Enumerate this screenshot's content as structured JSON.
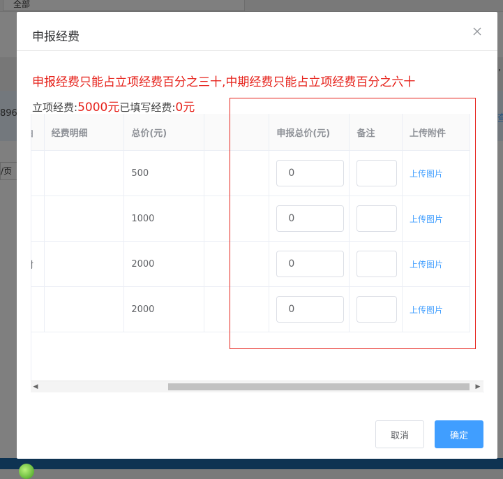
{
  "background": {
    "topbar_select": "全部",
    "left_fragments": [
      "896)",
      "/页",
      "由",
      "材"
    ],
    "right_fragments": [
      "’",
      "查"
    ]
  },
  "dialog": {
    "title": "申报经费",
    "notice": "申报经费只能占立项经费百分之三十,中期经费只能占立项经费百分之六十",
    "budget": {
      "label1": "立项经费:",
      "value1": "5000元",
      "label2": "已填写经费:",
      "value2": "0元"
    },
    "table": {
      "headers": {
        "reason": "由",
        "detail": "经费明细",
        "total": "总价(元)",
        "blank": "",
        "declared": "申报总价(元)",
        "remark": "备注",
        "upload": "上传附件"
      },
      "rows": [
        {
          "reason": "",
          "detail": "",
          "total": "500",
          "declared": "0",
          "remark": "",
          "upload": "上传图片"
        },
        {
          "reason": "",
          "detail": "",
          "total": "1000",
          "declared": "0",
          "remark": "",
          "upload": "上传图片"
        },
        {
          "reason": "材",
          "detail": "",
          "total": "2000",
          "declared": "0",
          "remark": "",
          "upload": "上传图片"
        },
        {
          "reason": "",
          "detail": "",
          "total": "2000",
          "declared": "0",
          "remark": "",
          "upload": "上传图片"
        }
      ]
    },
    "buttons": {
      "cancel": "取消",
      "confirm": "确定"
    }
  },
  "colors": {
    "primary": "#409eff",
    "alert_red": "#e6211a"
  }
}
